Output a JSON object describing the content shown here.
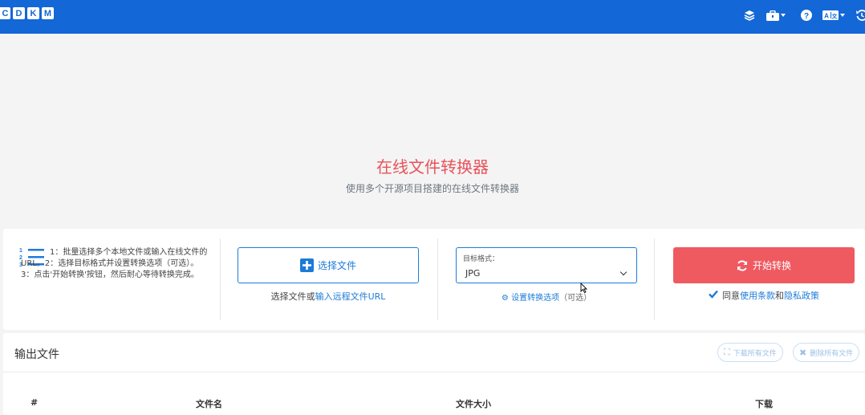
{
  "header": {
    "logo_letters": [
      "C",
      "D",
      "K",
      "M"
    ],
    "icons": [
      "layers-icon",
      "toolbox-icon",
      "help-icon",
      "language-icon",
      "history-icon"
    ]
  },
  "hero": {
    "title": "在线文件转换器",
    "subtitle": "使用多个开源项目搭建的在线文件转换器"
  },
  "converter": {
    "steps_text": "1：批量选择多个本地文件或输入在线文件的URL。2：选择目标格式并设置转换选项（可选）。3：点击'开始转换'按钮，然后耐心等待转换完成。",
    "choose_button": "选择文件",
    "choose_hint_prefix": "选择文件或",
    "choose_hint_link": "输入远程文件URL",
    "format_label": "目标格式：",
    "format_value": "JPG",
    "settings_link": "设置转换选项",
    "settings_suffix": "（可选）",
    "start_button": "开始转换",
    "agree_prefix": "同意",
    "agree_terms": "使用条款",
    "agree_and": "和",
    "agree_privacy": "隐私政策"
  },
  "output": {
    "title": "输出文件",
    "download_all": "下载所有文件",
    "delete_all": "删除所有文件",
    "columns": [
      "#",
      "文件名",
      "文件大小",
      "下载"
    ]
  },
  "colors": {
    "header": "#1367d6",
    "accent": "#1d7bd8",
    "start": "#ef5a61",
    "title": "#e8525a"
  }
}
